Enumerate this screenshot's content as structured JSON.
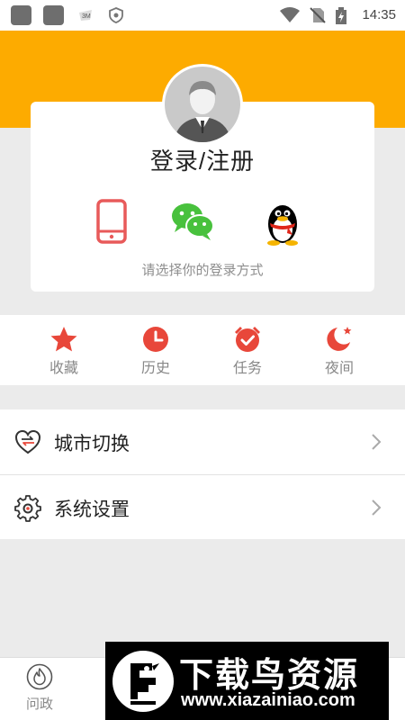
{
  "status_bar": {
    "time": "14:35",
    "icons": [
      "app-icon",
      "app-icon",
      "notification-icon",
      "shield-icon",
      "wifi-icon",
      "no-sim-icon",
      "battery-charging-icon"
    ]
  },
  "login_card": {
    "avatar_icon": "user-avatar-icon",
    "title": "登录/注册",
    "methods": [
      {
        "name": "phone",
        "icon": "phone-icon",
        "color": "#e85a5a"
      },
      {
        "name": "wechat",
        "icon": "wechat-icon",
        "color": "#48c13d"
      },
      {
        "name": "qq",
        "icon": "qq-penguin-icon",
        "color": "#000000"
      }
    ],
    "hint": "请选择你的登录方式"
  },
  "quick_actions": [
    {
      "label": "收藏",
      "icon": "star-icon"
    },
    {
      "label": "历史",
      "icon": "clock-icon"
    },
    {
      "label": "任务",
      "icon": "alarm-check-icon"
    },
    {
      "label": "夜间",
      "icon": "moon-icon"
    }
  ],
  "menu": [
    {
      "label": "城市切换",
      "icon": "city-switch-icon"
    },
    {
      "label": "系统设置",
      "icon": "gear-icon"
    }
  ],
  "tab_bar": [
    {
      "label": "问政",
      "icon": "fire-icon"
    }
  ],
  "watermark": {
    "title": "下载鸟资源",
    "url": "www.xiazainiao.com"
  },
  "colors": {
    "accent": "#fdab00",
    "icon_red": "#e8473a",
    "background": "#ebebeb"
  }
}
